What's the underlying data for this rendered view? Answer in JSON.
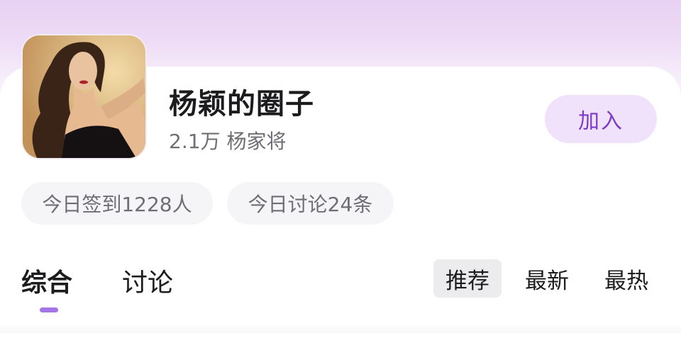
{
  "circle": {
    "name": "杨颖的圈子",
    "member_count": "2.1万",
    "member_title": "杨家将",
    "join_label": "加入"
  },
  "stats": [
    {
      "label": "今日签到1228人"
    },
    {
      "label": "今日讨论24条"
    }
  ],
  "tabs": [
    {
      "label": "综合",
      "active": true
    },
    {
      "label": "讨论",
      "active": false
    }
  ],
  "sort_options": [
    {
      "label": "推荐",
      "active": true
    },
    {
      "label": "最新",
      "active": false
    },
    {
      "label": "最热",
      "active": false
    }
  ],
  "colors": {
    "accent": "#7d3cc8",
    "join_bg": "#efe2fa",
    "indicator": "#a774e6",
    "header_gradient_top": "#e7d2f3"
  }
}
